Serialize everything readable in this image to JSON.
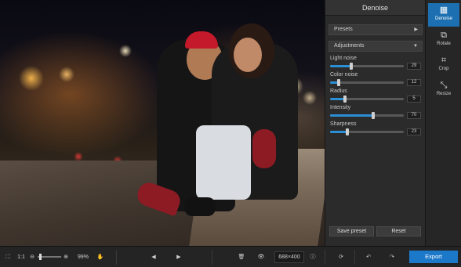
{
  "panel": {
    "title": "Denoise",
    "presets_label": "Presets",
    "adjustments_label": "Adjustments",
    "sliders": [
      {
        "label": "Light noise",
        "value": "29",
        "fraction": 0.29
      },
      {
        "label": "Color noise",
        "value": "12",
        "fraction": 0.12
      },
      {
        "label": "Radius",
        "value": "5",
        "fraction": 0.2
      },
      {
        "label": "Intensity",
        "value": "70",
        "fraction": 0.58
      },
      {
        "label": "Sharpness",
        "value": "23",
        "fraction": 0.23
      }
    ],
    "save_preset": "Save preset",
    "reset": "Reset"
  },
  "tools": [
    {
      "label": "Denoise",
      "icon": "denoise-icon",
      "active": true
    },
    {
      "label": "Rotate",
      "icon": "rotate-icon",
      "active": false
    },
    {
      "label": "Crop",
      "icon": "crop-icon",
      "active": false
    },
    {
      "label": "Resize",
      "icon": "resize-icon",
      "active": false
    }
  ],
  "bottom": {
    "ratio_label": "1:1",
    "zoom_value": "99%",
    "image_size": "688×400",
    "export_label": "Export"
  },
  "colors": {
    "accent": "#1c78c8",
    "slider_fill": "#2b8fd6"
  }
}
